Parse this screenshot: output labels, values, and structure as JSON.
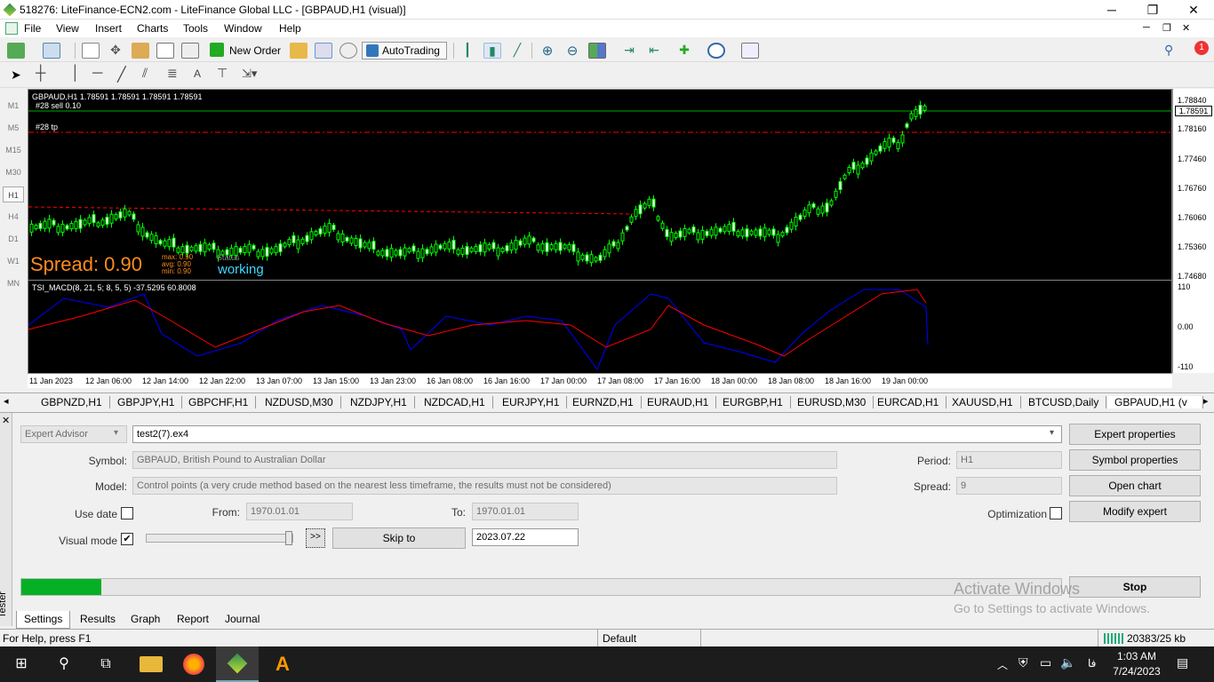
{
  "window": {
    "title": "518276: LiteFinance-ECN2.com - LiteFinance Global LLC - [GBPAUD,H1 (visual)]",
    "minimize": "─",
    "maximize": "❐",
    "close": "✕"
  },
  "menu": [
    "File",
    "View",
    "Insert",
    "Charts",
    "Tools",
    "Window",
    "Help"
  ],
  "toolbar": {
    "new_order": "New Order",
    "autotrading": "AutoTrading",
    "notif_count": "1"
  },
  "timeframes": [
    "M1",
    "M5",
    "M15",
    "M30",
    "H1",
    "H4",
    "D1",
    "W1",
    "MN"
  ],
  "chart": {
    "header": "GBPAUD,H1  1.78591 1.78591 1.78591 1.78591",
    "order_label": "#28 sell 0.10",
    "tp_label": "#28 tp",
    "spread": "Spread: 0.90",
    "max": "max: 0.90",
    "avg": "avg: 0.90",
    "min": "min: 0.90",
    "status_label": "Status",
    "status": "working",
    "current_price": "1.78591",
    "prices": [
      "1.78840",
      "1.78160",
      "1.77460",
      "1.76760",
      "1.76060",
      "1.75360",
      "1.74680"
    ],
    "candle_color": "#00ff00",
    "sell_line_color": "#00aa00",
    "tp_line_color": "#ff0000"
  },
  "indicator": {
    "header": "TSI_MACD(8, 21, 5; 8, 5, 5) -37.5295 60.8008",
    "levels": [
      "110",
      "0.00",
      "-110"
    ],
    "line1_color": "#0000ff",
    "line2_color": "#ff0000"
  },
  "time_labels": [
    "11 Jan 2023",
    "12 Jan 06:00",
    "12 Jan 14:00",
    "12 Jan 22:00",
    "13 Jan 07:00",
    "13 Jan 15:00",
    "13 Jan 23:00",
    "16 Jan 08:00",
    "16 Jan 16:00",
    "17 Jan 00:00",
    "17 Jan 08:00",
    "17 Jan 16:00",
    "18 Jan 00:00",
    "18 Jan 08:00",
    "18 Jan 16:00",
    "19 Jan 00:00"
  ],
  "symbol_tabs": [
    "GBPNZD,H1",
    "GBPJPY,H1",
    "GBPCHF,H1",
    "NZDUSD,M30",
    "NZDJPY,H1",
    "NZDCAD,H1",
    "EURJPY,H1",
    "EURNZD,H1",
    "EURAUD,H1",
    "EURGBP,H1",
    "EURUSD,M30",
    "EURCAD,H1",
    "XAUUSD,H1",
    "BTCUSD,Daily",
    "GBPAUD,H1 (v"
  ],
  "tester": {
    "type": "Expert Advisor",
    "expert": "test2(7).ex4",
    "symbol_label": "Symbol:",
    "symbol": "GBPAUD, British Pound to Australian Dollar",
    "model_label": "Model:",
    "model": "Control points (a very crude method based on the nearest less timeframe, the results must not be considered)",
    "use_date": "Use date",
    "from_label": "From:",
    "from": "1970.01.01",
    "to_label": "To:",
    "to": "1970.01.01",
    "visual_mode": "Visual mode",
    "visual_checked": "✔",
    "skip_btn": ">>",
    "skip_to": "Skip to",
    "skip_date": "2023.07.22",
    "period_label": "Period:",
    "period": "H1",
    "spread_label": "Spread:",
    "spread": "9",
    "optimization": "Optimization",
    "btn_expert_props": "Expert properties",
    "btn_symbol_props": "Symbol properties",
    "btn_open_chart": "Open chart",
    "btn_modify": "Modify expert",
    "btn_stop": "Stop",
    "progress": 0.077,
    "side_label": "Tester",
    "tabs": [
      "Settings",
      "Results",
      "Graph",
      "Report",
      "Journal"
    ],
    "watermark1": "Activate Windows",
    "watermark2": "Go to Settings to activate Windows."
  },
  "status": {
    "help": "For Help, press F1",
    "profile": "Default",
    "traffic": "20383/25 kb"
  },
  "taskbar": {
    "time": "1:03 AM",
    "date": "7/24/2023",
    "lang": "فا"
  }
}
